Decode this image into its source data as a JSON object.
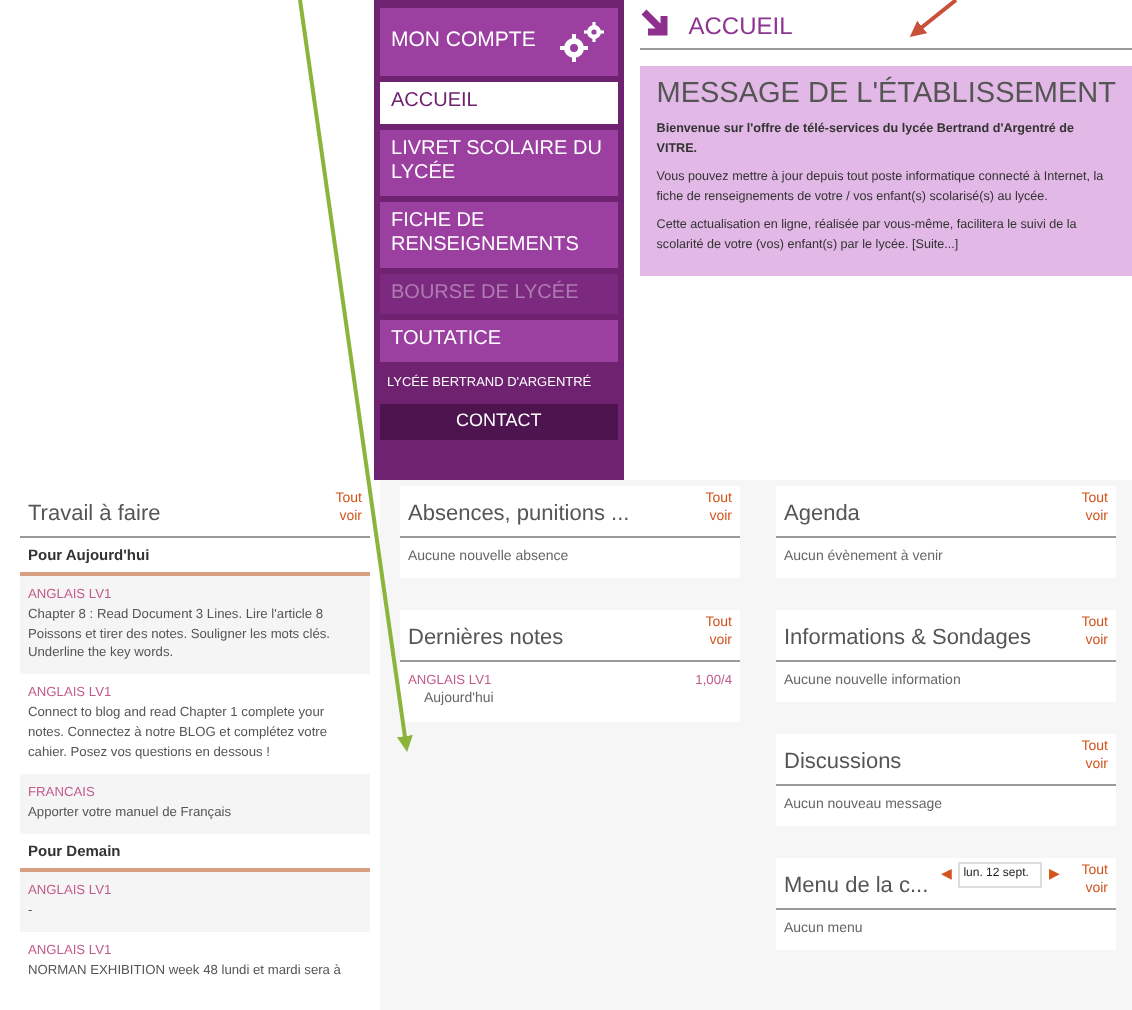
{
  "sidebar": {
    "header": "MON COMPTE",
    "items": [
      {
        "label": "ACCUEIL",
        "selected": true,
        "disabled": false
      },
      {
        "label": "LIVRET SCOLAIRE DU LYCÉE",
        "selected": false,
        "disabled": false
      },
      {
        "label": "FICHE DE RENSEIGNEMENTS",
        "selected": false,
        "disabled": false
      },
      {
        "label": "BOURSE DE LYCÉE",
        "selected": false,
        "disabled": true
      },
      {
        "label": "TOUTATICE",
        "selected": false,
        "disabled": false
      }
    ],
    "school": "LYCÉE BERTRAND D'ARGENTRÉ",
    "contact": "CONTACT"
  },
  "page": {
    "title": "ACCUEIL"
  },
  "message": {
    "title": "MESSAGE DE L'ÉTABLISSEMENT",
    "paragraphs": [
      "**Bienvenue sur l'offre de télé-services du lycée Bertrand d'Argentré de VITRE.**",
      "Vous pouvez mettre à jour depuis tout poste informatique connecté à Internet, la fiche de renseignements de votre / vos enfant(s) scolarisé(s) au lycée.",
      "Cette actualisation en ligne, réalisée par vous-même, facilitera le suivi de la scolarité de votre (vos) enfant(s) par le lycée. [Suite...]"
    ]
  },
  "homework": {
    "title": "Travail à faire",
    "link": "Tout voir",
    "groups": [
      {
        "heading": "Pour Aujourd'hui",
        "entries": [
          {
            "subject": "ANGLAIS LV1",
            "text": "Chapter 8 : Read Document 3 Lines. Lire l'article 8 Poissons et tirer des notes. Souligner les mots clés. Underline the key words."
          },
          {
            "subject": "ANGLAIS LV1",
            "text": "Connect to blog and read Chapter 1 complete your notes. Connectez à notre BLOG et complétez votre cahier. Posez vos questions en dessous !"
          },
          {
            "subject": "FRANCAIS",
            "text": "Apporter votre manuel de Français"
          }
        ]
      },
      {
        "heading": "Pour Demain",
        "entries": [
          {
            "subject": "ANGLAIS LV1",
            "text": "-"
          },
          {
            "subject": "ANGLAIS LV1",
            "text": "NORMAN EXHIBITION week 48 lundi et mardi sera à"
          }
        ]
      }
    ]
  },
  "columns": [
    [
      {
        "kind": "empty",
        "title": "Absences, punitions ...",
        "link": "Tout voir",
        "message": "Aucune nouvelle absence"
      },
      {
        "kind": "grades",
        "title": "Dernières notes",
        "link": "Tout voir",
        "rows": [
          {
            "subject": "ANGLAIS LV1",
            "date": "Aujourd'hui",
            "grade": "1,00/4"
          }
        ]
      }
    ],
    [
      {
        "kind": "empty",
        "title": "Agenda",
        "link": "Tout voir",
        "message": "Aucun évènement à venir"
      },
      {
        "kind": "empty",
        "title": "Informations & Sondages",
        "link": "Tout voir",
        "message": "Aucune nouvelle information"
      },
      {
        "kind": "empty",
        "title": "Discussions",
        "link": "Tout voir",
        "message": "Aucun nouveau message"
      },
      {
        "kind": "menu",
        "title": "Menu de la c...",
        "link": "Tout voir",
        "previous": "◀",
        "date": "lun. 12 sept.",
        "next": "▶",
        "message": "Aucun menu"
      }
    ]
  ]
}
